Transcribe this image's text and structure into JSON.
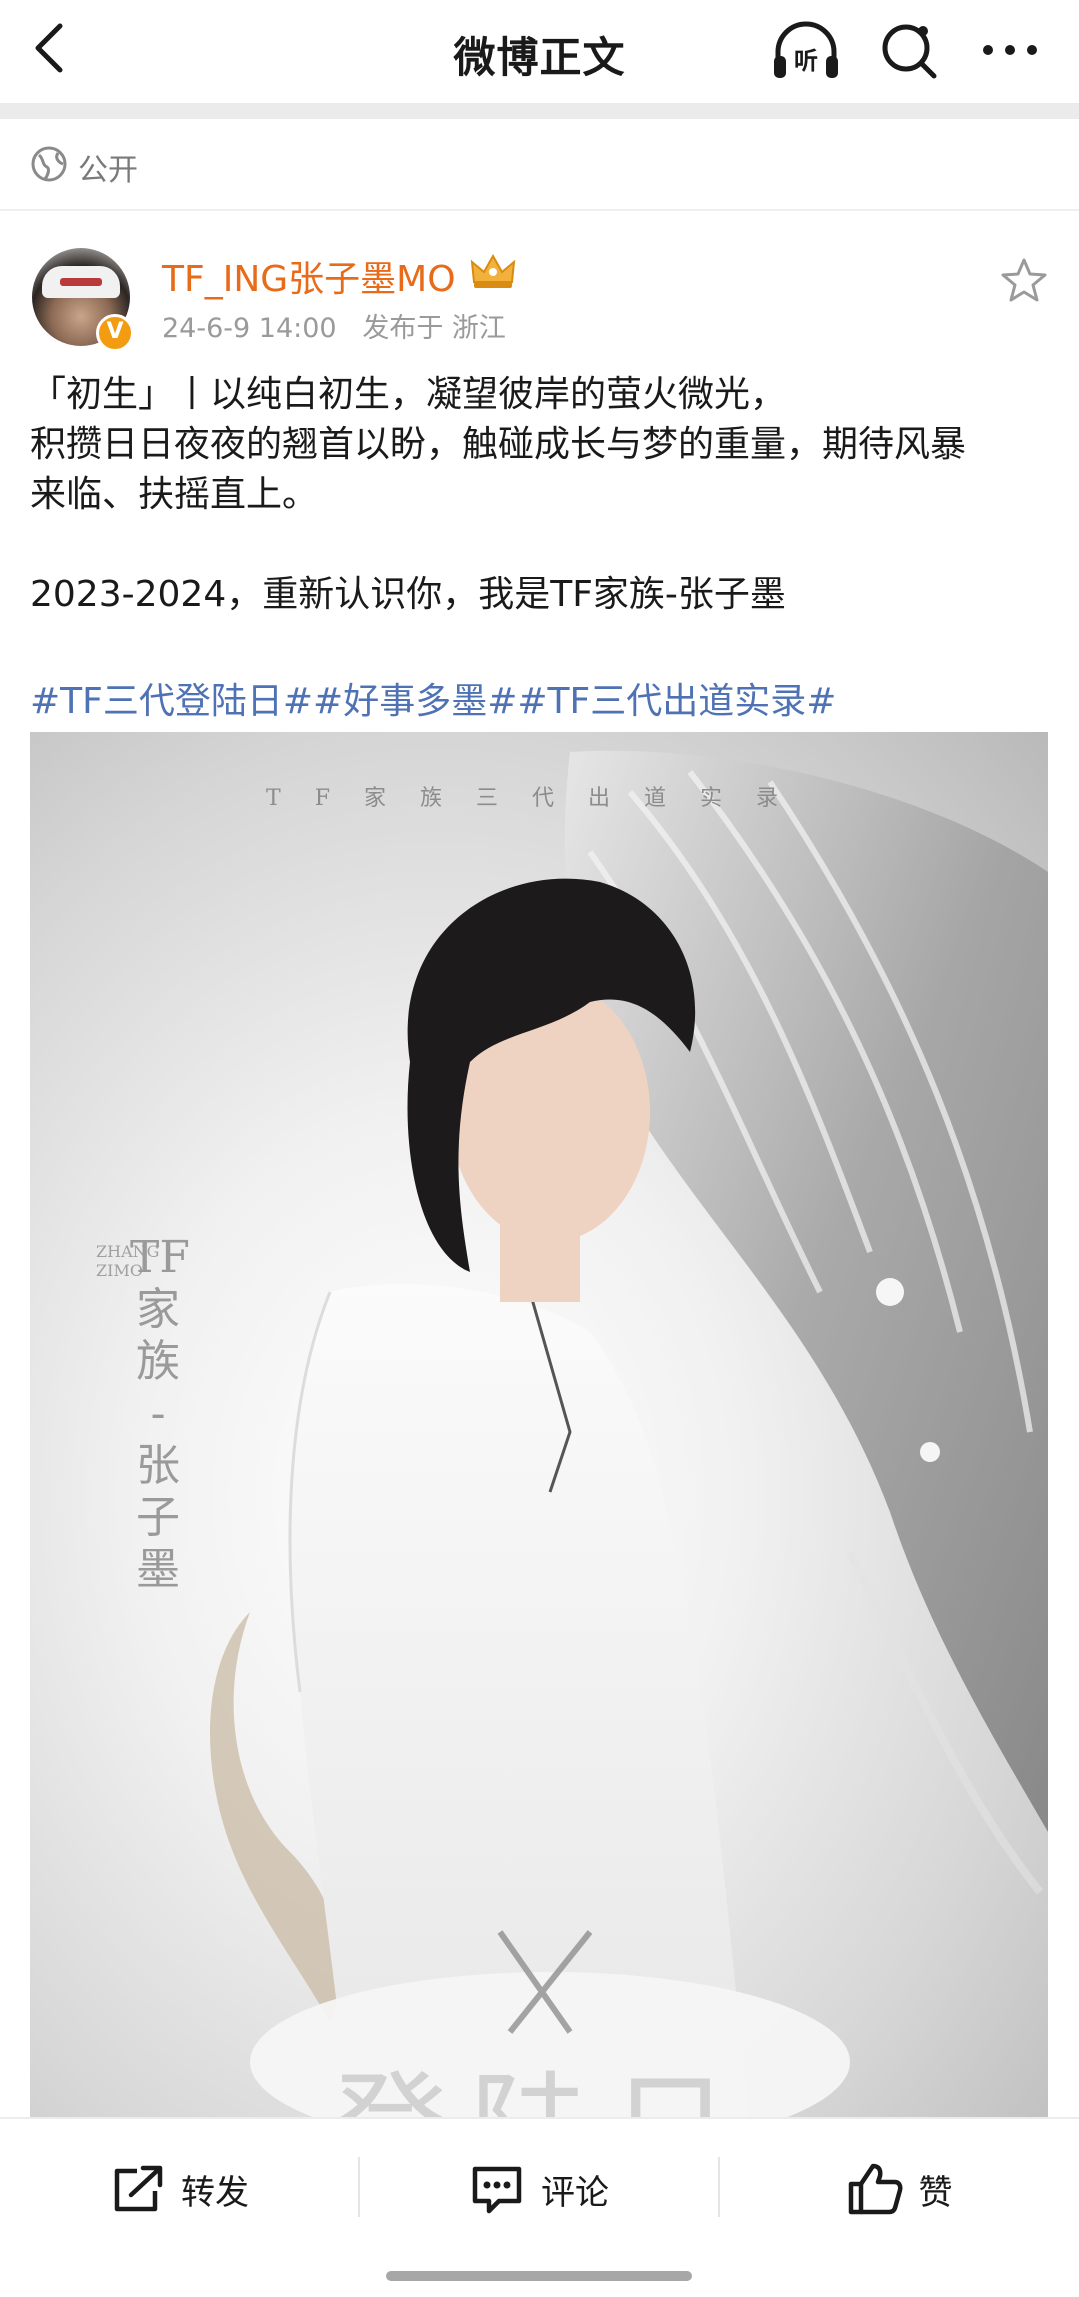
{
  "nav": {
    "title": "微博正文",
    "back_icon": "chevron-left-icon",
    "listen_label": "听",
    "search_icon": "search-icon",
    "more_icon": "more-dots-icon"
  },
  "visibility": {
    "icon": "globe-icon",
    "label": "公开"
  },
  "author": {
    "name": "TF_ING张子墨MO",
    "vip_icon": "crown-vip-icon",
    "verified_icon": "verified-badge-icon",
    "verified_mark": "V",
    "timestamp": "24-6-9 14:00",
    "location": "发布于 浙江",
    "favorite_icon": "star-icon"
  },
  "post": {
    "lines": [
      "「初生」丨以纯白初生，凝望彼岸的萤火微光，",
      "积攒日日夜夜的翘首以盼，触碰成长与梦的重量，期待风暴",
      "来临、扶摇直上。",
      "",
      "2023-2024，重新认识你，我是TF家族-张子墨"
    ],
    "hashtags": [
      "#TF三代登陆日#",
      "#好事多墨#",
      "#TF三代出道实录#"
    ]
  },
  "poster": {
    "header": "TF家族三代出道实录",
    "vertical_name": [
      "TF",
      "家",
      "族",
      "-",
      "张",
      "子",
      "墨"
    ],
    "vertical_english": "ZHANG ZIMO",
    "footer_text": "登陆日"
  },
  "actions": {
    "repost_label": "转发",
    "comment_label": "评论",
    "like_label": "赞",
    "repost_icon": "share-out-icon",
    "comment_icon": "comment-bubble-icon",
    "like_icon": "thumbs-up-icon"
  },
  "colors": {
    "accent_orange": "#e86b1a",
    "hashtag_blue": "#4f72b4",
    "meta_gray": "#9a9a9a",
    "verified_badge": "#f39c12"
  }
}
